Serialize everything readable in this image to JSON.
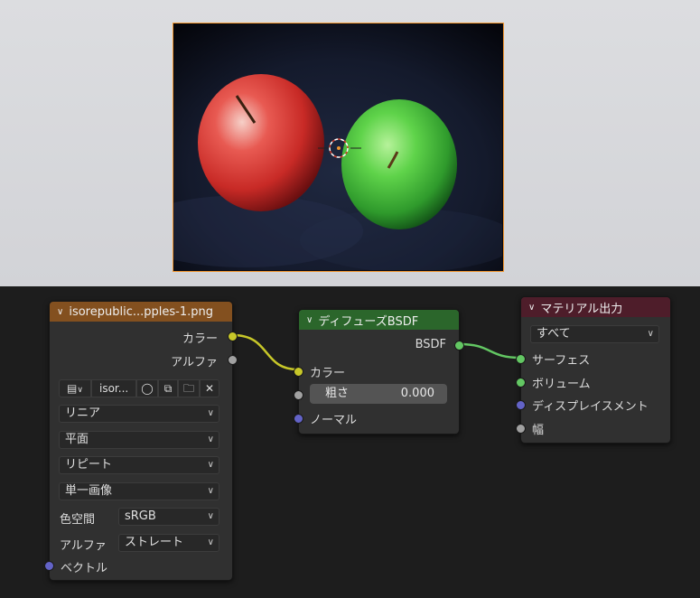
{
  "viewport": {
    "image_alt": "Red and green apples on dark background"
  },
  "image_node": {
    "title": "isorepublic...pples-1.png",
    "out_color": "カラー",
    "out_alpha": "アルファ",
    "image_name": "isor...",
    "interpolation": "リニア",
    "projection": "平面",
    "extension": "リピート",
    "source": "単一画像",
    "colorspace_label": "色空間",
    "colorspace_value": "sRGB",
    "alpha_label": "アルファ",
    "alpha_value": "ストレート",
    "in_vector": "ベクトル"
  },
  "diffuse_node": {
    "title": "ディフューズBSDF",
    "out_bsdf": "BSDF",
    "in_color": "カラー",
    "roughness_label": "粗さ",
    "roughness_value": "0.000",
    "in_normal": "ノーマル"
  },
  "output_node": {
    "title": "マテリアル出力",
    "target": "すべて",
    "in_surface": "サーフェス",
    "in_volume": "ボリューム",
    "in_displacement": "ディスプレイスメント",
    "in_width": "幅"
  },
  "colors": {
    "image_header": "#83501f",
    "diffuse_header": "#2b662b",
    "output_header": "#4e1d2a",
    "socket_color": "#c7c729",
    "socket_gray": "#a1a1a1",
    "socket_shader": "#63c763",
    "socket_vector": "#6363c7",
    "selection": "#f0952e"
  }
}
